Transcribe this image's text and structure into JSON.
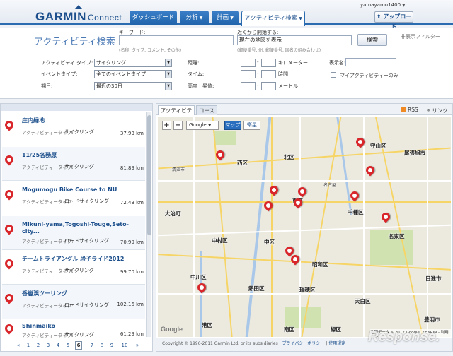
{
  "header": {
    "logo_main": "GARMIN",
    "logo_sub": "Connect",
    "username": "yamayamu1400",
    "upload_label": "アップロード",
    "tabs": [
      {
        "label": "ダッシュボード"
      },
      {
        "label": "分析"
      },
      {
        "label": "計画"
      },
      {
        "label": "アクティビティ検索"
      }
    ]
  },
  "search": {
    "title": "アクティビティ検索",
    "keyword_label": "キーワード:",
    "keyword_value": "",
    "keyword_hint": "(名称, タイプ, コメント, その他)",
    "near_label": "近くから開始する:",
    "near_value": "現在の地図を表示",
    "near_hint": "(郵便番号, 州, 郵便番号, 国名の組み合わせ)",
    "search_button": "検索",
    "filter_toggle": "非表示フィルター",
    "activity_type_label": "アクティビティ タイプ:",
    "activity_type_value": "サイクリング",
    "event_type_label": "イベントタイプ:",
    "event_type_value": "全てのイベントタイプ",
    "period_label": "期日:",
    "period_value": "最近の30日",
    "distance_label": "距離:",
    "distance_unit": "キロメーター",
    "time_label": "タイム:",
    "time_unit": "時間",
    "elevation_label": "高度上昇値:",
    "elevation_unit": "メートル",
    "display_name_label": "表示名:",
    "my_activities_label": "マイアクティビティーのみ"
  },
  "list": {
    "type_label": "アクティビティータイプ:",
    "items": [
      {
        "title": "庄内緑地",
        "type": "サイクリング",
        "distance": "37.93 km"
      },
      {
        "title": "11/25各務原",
        "type": "サイクリング",
        "distance": "81.89 km"
      },
      {
        "title": "Mogumogu Bike Course to NU",
        "type": "ロードサイクリング",
        "distance": "72.43 km"
      },
      {
        "title": "Mikuni-yama,Togoshi-Touge,Seto-city...",
        "type": "ロードサイクリング",
        "distance": "70.99 km"
      },
      {
        "title": "チームトライアングル 段子ライド2012",
        "type": "サイクリング",
        "distance": "99.70 km"
      },
      {
        "title": "香嵐渓ツーリング",
        "type": "ロードサイクリング",
        "distance": "102.16 km"
      },
      {
        "title": "Shinmaiko",
        "type": "サイクリング",
        "distance": "61.29 km"
      }
    ],
    "pager": {
      "prev": "«",
      "pages": [
        "1",
        "2",
        "3",
        "4",
        "5",
        "6",
        "7",
        "8",
        "9",
        "10"
      ],
      "current": "6",
      "next": "»"
    }
  },
  "map": {
    "tabs": [
      {
        "label": "アクティビティ"
      },
      {
        "label": "コース"
      }
    ],
    "rss_label": "RSS",
    "link_label": "リンク",
    "zoom_in": "+",
    "zoom_out": "−",
    "maptype_value": "Google",
    "btn_map": "マップ",
    "btn_sat": "衛星",
    "labels": {
      "kita": "北区",
      "moriyama": "守山区",
      "nishi": "西区",
      "higashi": "東区",
      "chikusa": "千種区",
      "meito": "名東区",
      "naka": "中区",
      "nakamura": "中村区",
      "showa": "昭和区",
      "nakagawa": "中川区",
      "atsuta": "熱田区",
      "mizuho": "瑞穂区",
      "tenpaku": "天白区",
      "minato": "港区",
      "minami": "南区",
      "midori": "緑区",
      "owariasahi": "尾張旭市",
      "nisshin": "日進市",
      "ogaki": "大治町",
      "kiyosu": "清須市",
      "toyoake": "豊明市",
      "nagoya": "名古屋"
    },
    "google_logo": "Google",
    "map_data": "地図データ ©2012 Google, ZENRIN - 利用規約",
    "footer": "Copyright © 1996-2011 Garmin Ltd. or its subsidiaries",
    "footer_privacy": "プライバシーポリシー",
    "footer_terms": "使用規定"
  },
  "watermark": "Response."
}
